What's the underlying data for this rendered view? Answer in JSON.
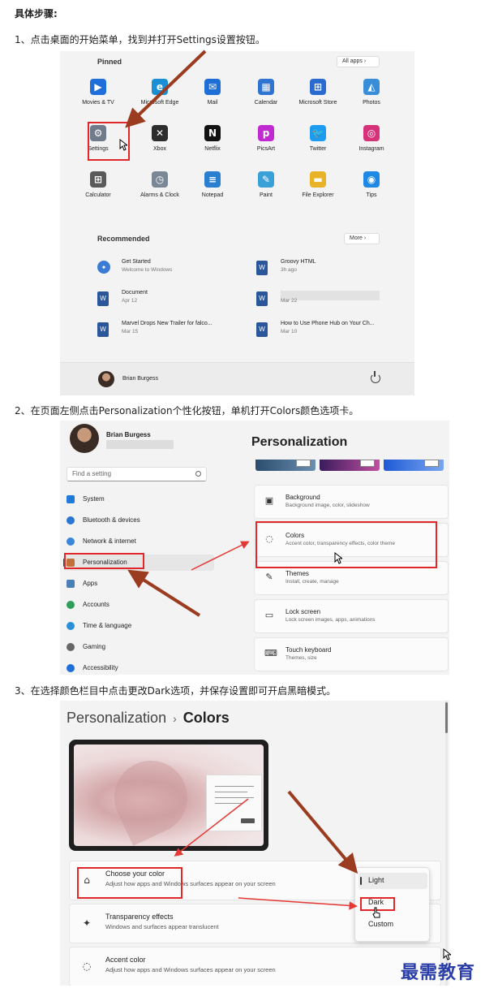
{
  "heading": "具体步骤:",
  "steps": [
    "1、点击桌面的开始菜单，找到并打开Settings设置按钮。",
    "2、在页面左侧点击Personalization个性化按钮，单机打开Colors颜色选项卡。",
    "3、在选择颜色栏目中点击更改Dark选项，并保存设置即可开启黑暗模式。"
  ],
  "start_menu": {
    "pinned_title": "Pinned",
    "all_apps_label": "All apps  ›",
    "apps": [
      {
        "label": "Movies & TV",
        "icon": "movies-tv-icon",
        "color": "#1e6fd9",
        "glyph": "▶"
      },
      {
        "label": "Microsoft Edge",
        "icon": "edge-icon",
        "color": "#1a8fd6",
        "glyph": "e"
      },
      {
        "label": "Mail",
        "icon": "mail-icon",
        "color": "#1d6fd6",
        "glyph": "✉"
      },
      {
        "label": "Calendar",
        "icon": "calendar-icon",
        "color": "#2f74d0",
        "glyph": "▦"
      },
      {
        "label": "Microsoft Store",
        "icon": "store-icon",
        "color": "#2a6bcf",
        "glyph": "⊞"
      },
      {
        "label": "Photos",
        "icon": "photos-icon",
        "color": "#3a8ed8",
        "glyph": "◭"
      },
      {
        "label": "Settings",
        "icon": "settings-gear-icon",
        "color": "#6f7b8a",
        "glyph": "⚙"
      },
      {
        "label": "Xbox",
        "icon": "xbox-icon",
        "color": "#2c2c2c",
        "glyph": "✕"
      },
      {
        "label": "Netflix",
        "icon": "netflix-icon",
        "color": "#121212",
        "glyph": "N"
      },
      {
        "label": "PicsArt",
        "icon": "picsart-icon",
        "color": "#c02ad0",
        "glyph": "p"
      },
      {
        "label": "Twitter",
        "icon": "twitter-icon",
        "color": "#1d9bf0",
        "glyph": "🐦"
      },
      {
        "label": "Instagram",
        "icon": "instagram-icon",
        "color": "#d6327a",
        "glyph": "◎"
      },
      {
        "label": "Calculator",
        "icon": "calculator-icon",
        "color": "#5a5a5a",
        "glyph": "⊞"
      },
      {
        "label": "Alarms & Clock",
        "icon": "clock-icon",
        "color": "#7a8796",
        "glyph": "◷"
      },
      {
        "label": "Notepad",
        "icon": "notepad-icon",
        "color": "#2a7fd0",
        "glyph": "≡"
      },
      {
        "label": "Paint",
        "icon": "paint-icon",
        "color": "#3aa0d8",
        "glyph": "✎"
      },
      {
        "label": "File Explorer",
        "icon": "file-explorer-icon",
        "color": "#e8b326",
        "glyph": "▬"
      },
      {
        "label": "Tips",
        "icon": "tips-icon",
        "color": "#1e88e5",
        "glyph": "◉"
      }
    ],
    "recommended_title": "Recommended",
    "more_label": "More  ›",
    "recommended": [
      {
        "title": "Get Started",
        "sub": "Welcome to Windows",
        "icon": "get-started-icon",
        "kind": "app"
      },
      {
        "title": "Groovy HTML",
        "sub": "3h ago",
        "icon": "word-doc-icon",
        "kind": "doc"
      },
      {
        "title": "Document",
        "sub": "Apr 12",
        "icon": "word-doc-icon",
        "kind": "doc"
      },
      {
        "title": "",
        "sub": "Mar 22",
        "icon": "word-doc-icon",
        "kind": "doc-redacted"
      },
      {
        "title": "Marvel Drops New Trailer for falco...",
        "sub": "Mar 15",
        "icon": "word-doc-icon",
        "kind": "doc"
      },
      {
        "title": "How to Use Phone Hub on Your Ch...",
        "sub": "Mar 10",
        "icon": "word-doc-icon",
        "kind": "doc"
      }
    ],
    "user_name": "Brian Burgess"
  },
  "settings": {
    "user_name": "Brian Burgess",
    "search_placeholder": "Find a setting",
    "nav": [
      {
        "label": "System",
        "icon": "system-icon",
        "color": "#1f7ad9"
      },
      {
        "label": "Bluetooth & devices",
        "icon": "bluetooth-icon",
        "color": "#2b76d2"
      },
      {
        "label": "Network & internet",
        "icon": "wifi-icon",
        "color": "#3b86d8"
      },
      {
        "label": "Personalization",
        "icon": "brush-icon",
        "color": "#c0713a"
      },
      {
        "label": "Apps",
        "icon": "apps-icon",
        "color": "#4a7fb8"
      },
      {
        "label": "Accounts",
        "icon": "accounts-icon",
        "color": "#2f9e5a"
      },
      {
        "label": "Time & language",
        "icon": "time-language-icon",
        "color": "#2a8fd8"
      },
      {
        "label": "Gaming",
        "icon": "gaming-icon",
        "color": "#666666"
      },
      {
        "label": "Accessibility",
        "icon": "accessibility-icon",
        "color": "#1e6fd9"
      }
    ],
    "page_title": "Personalization",
    "cards": [
      {
        "title": "Background",
        "sub": "Background image, color, slideshow",
        "icon": "image-icon",
        "glyph": "▣"
      },
      {
        "title": "Colors",
        "sub": "Accent color, transparency effects, color theme",
        "icon": "palette-icon",
        "glyph": "◌"
      },
      {
        "title": "Themes",
        "sub": "Install, create, manage",
        "icon": "themes-brush-icon",
        "glyph": "✎"
      },
      {
        "title": "Lock screen",
        "sub": "Lock screen images, apps, animations",
        "icon": "lock-screen-icon",
        "glyph": "▭"
      },
      {
        "title": "Touch keyboard",
        "sub": "Themes, size",
        "icon": "keyboard-icon",
        "glyph": "⌨"
      }
    ]
  },
  "colors_page": {
    "breadcrumb_parent": "Personalization",
    "breadcrumb_separator": "›",
    "breadcrumb_current": "Colors",
    "options": [
      {
        "title": "Choose your color",
        "sub": "Adjust how apps and Windows surfaces appear on your screen",
        "icon": "color-brush-icon",
        "glyph": "⌂"
      },
      {
        "title": "Transparency effects",
        "sub": "Windows and surfaces appear translucent",
        "icon": "sparkle-icon",
        "glyph": "✦"
      },
      {
        "title": "Accent color",
        "sub": "Adjust how apps and Windows surfaces appear on your screen",
        "icon": "palette-icon",
        "glyph": "◌"
      }
    ],
    "dropdown_options": [
      "Light",
      "Dark",
      "Custom"
    ],
    "dropdown_selected": "Light"
  },
  "watermark": "最需教育",
  "colors": {
    "highlight_red": "#e0282a",
    "arrow_brown": "#9b3b1f",
    "arrow_red": "#e53935",
    "watermark_blue": "#2b3ea8"
  }
}
